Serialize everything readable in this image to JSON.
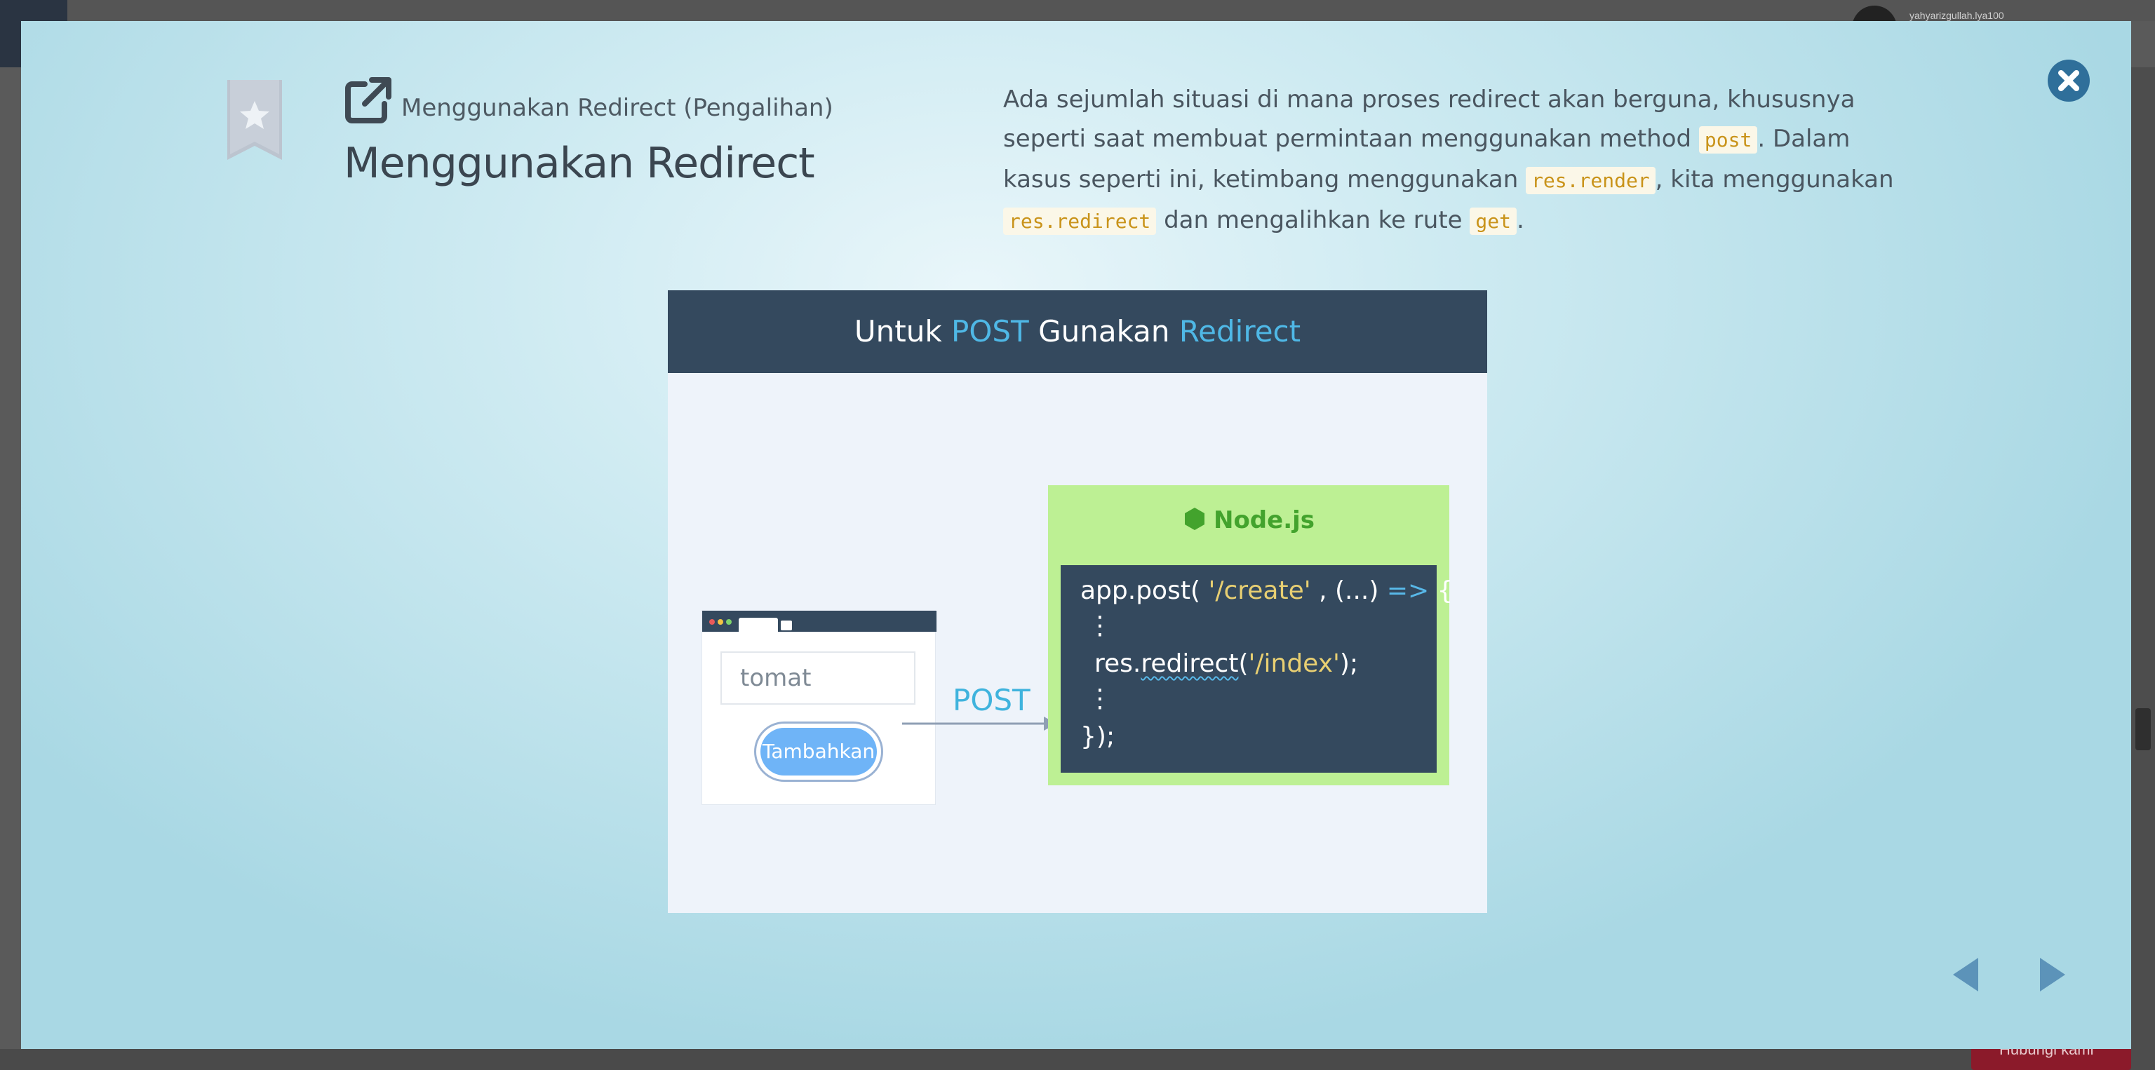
{
  "background": {
    "username": "yahyarizgullah.lya100",
    "help_button_label": "Hubungi kami"
  },
  "lesson": {
    "chapter_label": "Menggunakan Redirect (Pengalihan)",
    "title": "Menggunakan Redirect",
    "description": {
      "p1": "Ada sejumlah situasi di mana proses redirect akan berguna, khususnya seperti saat membuat permintaan menggunakan method ",
      "code1": "post",
      "p2": ". Dalam kasus seperti ini, ketimbang menggunakan ",
      "code2": "res.render",
      "p3": ", kita menggunakan ",
      "code3": "res.redirect",
      "p4": " dan mengalihkan ke rute ",
      "code4": "get",
      "p5": "."
    }
  },
  "slide": {
    "title_part1": "Untuk ",
    "title_post": "POST",
    "title_part2": " Gunakan ",
    "title_redirect": "Redirect",
    "input_value": "tomat",
    "button_label": "Tambahkan",
    "arrow_label": "POST",
    "server_title": "Node.js",
    "code": {
      "l1_a": "app.post( ",
      "l1_str": "'/create'",
      "l1_b": " ,  (...) ",
      "l1_op": "=>",
      "l1_c": " {",
      "dots": "⋮",
      "l3_a": "res.",
      "l3_fn": "redirect",
      "l3_b": "(",
      "l3_str": "'/index'",
      "l3_c": ");",
      "l5": "});"
    }
  },
  "icons": {
    "close": "close-icon",
    "prev": "arrow-left-icon",
    "next": "arrow-right-icon",
    "bookmark": "bookmark-star-icon",
    "external_link": "external-link-icon"
  },
  "colors": {
    "accent_blue": "#4fb8e6",
    "slide_header": "#34495e",
    "node_green": "#43a32d",
    "code_yellow": "#c9931a",
    "close_button": "#2f6f9a"
  }
}
